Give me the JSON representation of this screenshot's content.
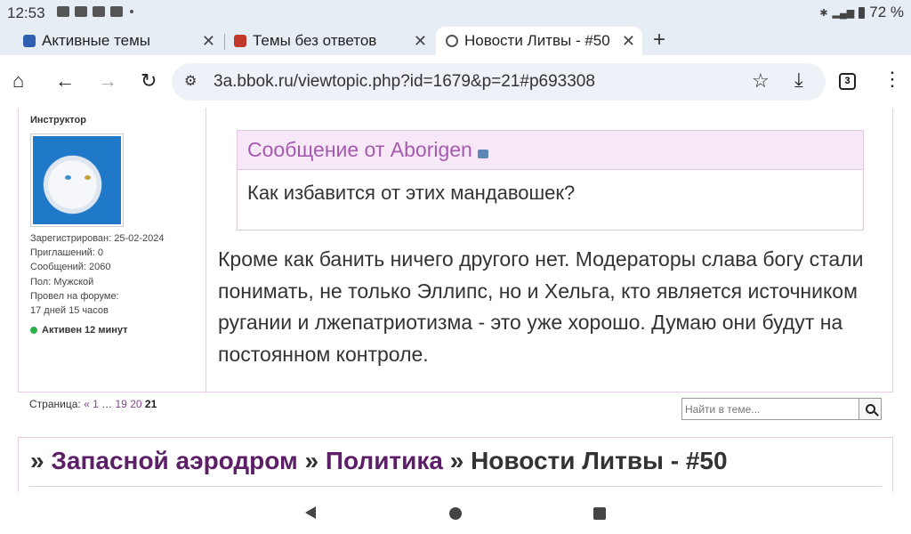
{
  "status": {
    "time": "12:53",
    "battery": "72 %"
  },
  "tabs": [
    {
      "label": "Активные темы",
      "favicon_color": "#2f5fb0"
    },
    {
      "label": "Темы без ответов",
      "favicon_color": "#c0392b"
    },
    {
      "label": "Новости Литвы - #50",
      "favicon_color": "#555555"
    }
  ],
  "address": {
    "url": "3a.bbok.ru/viewtopic.php?id=1679&p=21#p693308",
    "tab_count": "3"
  },
  "profile": {
    "role": "Инструктор",
    "registered": "Зарегистрирован: 25-02-2024",
    "invites": "Приглашений: 0",
    "posts": "Сообщений: 2060",
    "gender": "Пол: Мужской",
    "time_on_forum_1": "Провел на форуме:",
    "time_on_forum_2": "17 дней 15 часов",
    "active": "Активен 12 минут"
  },
  "quote": {
    "header": "Сообщение от Aborigen",
    "body": "Как избавится от этих мандавошек?"
  },
  "post_text": "Кроме как банить ничего другого нет. Модераторы слава богу стали понимать, не только Эллипс, но и Хельга, кто является источником ругании и лжепатриотизма - это уже хорошо. Думаю они будут на постоянном контроле.",
  "pager": {
    "label": "Страница:",
    "prev": "«",
    "p1": "1",
    "ellipsis": "…",
    "p19": "19",
    "p20": "20",
    "current": "21"
  },
  "search": {
    "placeholder": "Найти в теме..."
  },
  "breadcrumbs": {
    "sep": "»",
    "item1": "Запасной аэродром",
    "item2": "Политика",
    "item3": "Новости Литвы - #50"
  }
}
